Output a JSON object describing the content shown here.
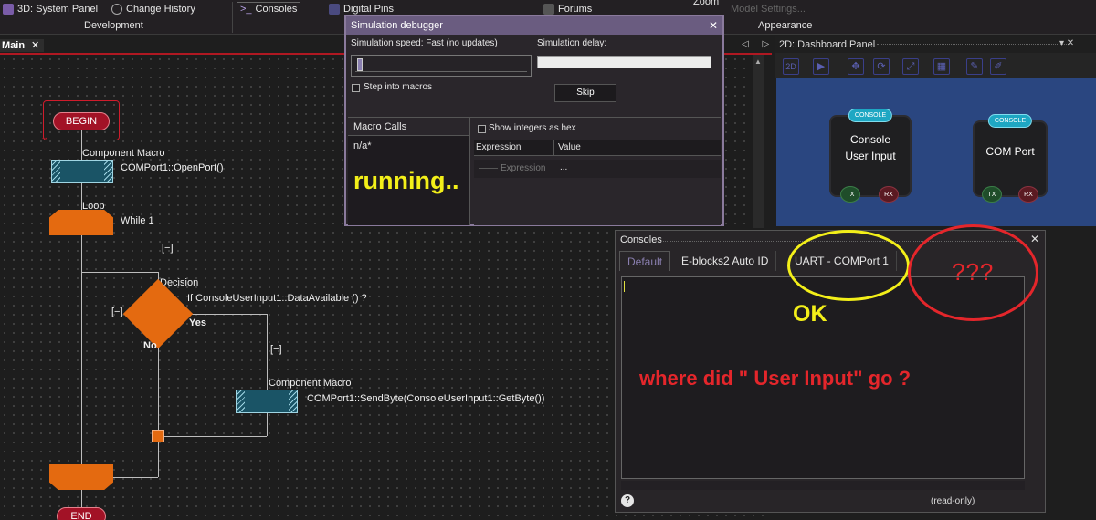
{
  "ribbon": {
    "buttons": [
      {
        "label": "3D: System Panel",
        "icon": "cube-icon"
      },
      {
        "label": "Change History",
        "icon": "history-icon"
      },
      {
        "label": "Consoles",
        "icon": "console-icon"
      },
      {
        "label": "Digital Pins",
        "icon": "pins-icon"
      },
      {
        "label": "Forums",
        "icon": "forums-icon"
      },
      {
        "label": "Zoom",
        "icon": "zoom-icon"
      }
    ],
    "groups": [
      "Development",
      "Appearance"
    ],
    "faded_label": "Model Settings..."
  },
  "flowchart": {
    "tab_label": "Main",
    "tab_close": "✕",
    "nav_arrows": "◁ ▷",
    "begin": "BEGIN",
    "end": "END",
    "macro1": {
      "type": "Component Macro",
      "call": "COMPort1::OpenPort()"
    },
    "loop": {
      "label": "Loop",
      "condition": "While 1"
    },
    "collapse_marker": "[−]",
    "decision": {
      "label": "Decision",
      "condition": "If ConsoleUserInput1::DataAvailable () ?",
      "yes": "Yes",
      "no": "No"
    },
    "macro2": {
      "type": "Component Macro",
      "call": "COMPort1::SendByte(ConsoleUserInput1::GetByte())"
    }
  },
  "sim_debugger": {
    "title": "Simulation debugger",
    "close": "✕",
    "speed_label": "Simulation speed: Fast (no updates)",
    "delay_label": "Simulation delay:",
    "step_into_macros": "Step into macros",
    "skip": "Skip",
    "macro_calls_header": "Macro Calls",
    "macro_calls_value": "n/a*",
    "show_hex": "Show integers as hex",
    "col_expression": "Expression",
    "col_value": "Value",
    "row_expression": "Expression",
    "row_value": "..."
  },
  "dashboard": {
    "title": "2D: Dashboard Panel",
    "tool_first": "2D",
    "components": [
      {
        "badge": "CONSOLE",
        "label": "Console User Input",
        "tx": "TX",
        "rx": "RX"
      },
      {
        "badge": "CONSOLE",
        "label": "COM Port",
        "tx": "TX",
        "rx": "RX"
      }
    ]
  },
  "consoles": {
    "title": "Consoles",
    "close": "✕",
    "tabs": [
      "Default",
      "E-blocks2 Auto ID",
      "UART - COMPort 1"
    ],
    "status": "(read-only)",
    "help": "?"
  },
  "annotations": {
    "running": "running..",
    "ok": "OK",
    "question": "where did \" User Input\" go ?",
    "qqq": "???"
  },
  "colors": {
    "accent_purple": "#6a5c80",
    "flow_orange": "#e46a10",
    "begin_red": "#a21226",
    "annotation_yellow": "#f3ef19",
    "annotation_red": "#e4262b",
    "dashboard_blue": "#2a4680"
  }
}
